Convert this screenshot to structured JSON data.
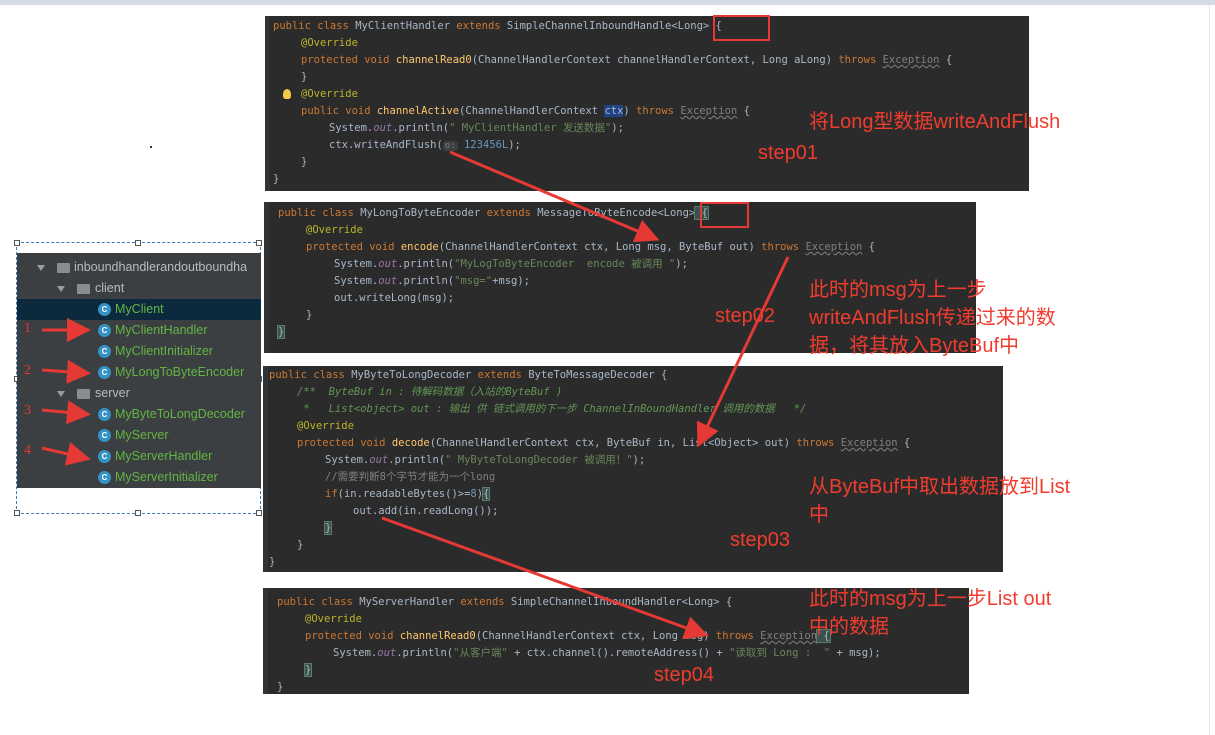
{
  "colors": {
    "annotation_red": "#f03c2e",
    "editor_bg": "#2b2b2b",
    "tree_bg": "#3c3f41",
    "class_green": "#62b543"
  },
  "step01": {
    "code": {
      "l1": {
        "a": "public class ",
        "b": "MyClientHandler ",
        "c": "extends ",
        "d": "SimpleChannelInboundHandle",
        "e": "<Long>",
        "f": " {"
      },
      "l2": "@Override",
      "l3": {
        "a": "protected void ",
        "b": "channelRead0",
        "c": "(ChannelHandlerContext channelHandlerContext, Long aLong) ",
        "d": "throws ",
        "e": "Exception",
        "f": " {"
      },
      "l4": "}",
      "l5": "@Override",
      "l6": {
        "a": "public void ",
        "b": "channelActive",
        "c": "(ChannelHandlerContext ",
        "d": "ctx",
        "e": ") ",
        "f": "throws ",
        "g": "Exception",
        "h": " {"
      },
      "l7": {
        "a": "System.",
        "b": "out",
        "c": ".println(",
        "d": "\" MyClientHandler 发送数据\"",
        "e": ");"
      },
      "l8": {
        "a": "ctx",
        "b": ".writeAndFlush(",
        "c": "o:",
        "d": "123456L",
        "e": ");"
      },
      "l9": "}",
      "l10": "}"
    },
    "note": "将Long型数据writeAndFlush",
    "label": "step01"
  },
  "step02": {
    "code": {
      "l1": {
        "a": "public class ",
        "b": "MyLongToByteEncoder ",
        "c": "extends ",
        "d": "MessageToByteEncode",
        "e": "<Long>",
        "f": " {"
      },
      "l2": "@Override",
      "l3": {
        "a": "protected void ",
        "b": "encode",
        "c": "(ChannelHandlerContext ctx, Long msg, ByteBuf out) ",
        "d": "throws ",
        "e": "Exception",
        "f": " {"
      },
      "l4": {
        "a": "System.",
        "b": "out",
        "c": ".println(",
        "d": "\"MyLogToByteEncoder  encode 被调用 \"",
        "e": ");"
      },
      "l5": {
        "a": "System.",
        "b": "out",
        "c": ".println(",
        "d": "\"msg=\"",
        "e": "+msg);"
      },
      "l6": "out.writeLong(msg);",
      "l7": "}",
      "l8": "}"
    },
    "note": [
      "此时的msg为上一步",
      "writeAndFlush传递过来的数",
      "据，将其放入ByteBuf中"
    ],
    "label": "step02"
  },
  "step03": {
    "code": {
      "l1": {
        "a": "public class ",
        "b": "MyByteToLongDecoder ",
        "c": "extends ",
        "d": "ByteToMessageDecoder {"
      },
      "l2": {
        "a": "/**  ",
        "b": "ByteBuf in ",
        "c": ": 待解码数据（入站的",
        "d": "ByteBuf ",
        "e": ")"
      },
      "l3": {
        "a": " *   ",
        "b": "List<object> out ",
        "c": ": 输出 供 链式调用的下一步 ",
        "d": "ChannelInBoundHandler ",
        "e": "调用的数据   */"
      },
      "l4": "@Override",
      "l5": {
        "a": "protected void ",
        "b": "decode",
        "c": "(ChannelHandlerContext ctx, ByteBuf in, List<Object> out) ",
        "d": "throws ",
        "e": "Exception",
        "f": " {"
      },
      "l6": {
        "a": "System.",
        "b": "out",
        "c": ".println(",
        "d": "\" MyByteToLongDecoder 被调用！\"",
        "e": ");"
      },
      "l7": "//需要判断8个字节才能为一个long",
      "l8": {
        "a": "if",
        "b": "(in.readableBytes()>=",
        "c": "8",
        "d": ")",
        "e": "{"
      },
      "l9": "out.add(in.readLong());",
      "l10": "}",
      "l11": "}",
      "l12": "}"
    },
    "note": [
      "从ByteBuf中取出数据放到List",
      "中"
    ],
    "label": "step03"
  },
  "step04": {
    "code": {
      "l1": {
        "a": "public class ",
        "b": "MyServerHandler ",
        "c": "extends ",
        "d": "SimpleChannelInboundHandler<Long> {"
      },
      "l2": "@Override",
      "l3": {
        "a": "protected void ",
        "b": "channelRead0",
        "c": "(ChannelHandlerContext ctx, Long msg) ",
        "d": "throws ",
        "e": "Exception",
        "f": " {"
      },
      "l4": {
        "a": "System.",
        "b": "out",
        "c": ".println(",
        "d": "\"从客户端\"",
        "e": " + ctx.channel().remoteAddress() + ",
        "f": "\"读取到 ",
        "g": "Long",
        "h": " :  \"",
        "i": " + msg);"
      },
      "l5": "}",
      "l6": "}"
    },
    "note": [
      "此时的msg为上一步List out",
      "中的数据"
    ],
    "label": "step04"
  },
  "tree": {
    "root": "inboundhandlerandoutboundha",
    "client_folder": "client",
    "server_folder": "server",
    "items": [
      "MyClient",
      "MyClientHandler",
      "MyClientInitializer",
      "MyLongToByteEncoder",
      "MyByteToLongDecoder",
      "MyServer",
      "MyServerHandler",
      "MyServerInitializer"
    ],
    "class_icon": "C",
    "markers": [
      "1",
      "2",
      "3",
      "4"
    ]
  }
}
